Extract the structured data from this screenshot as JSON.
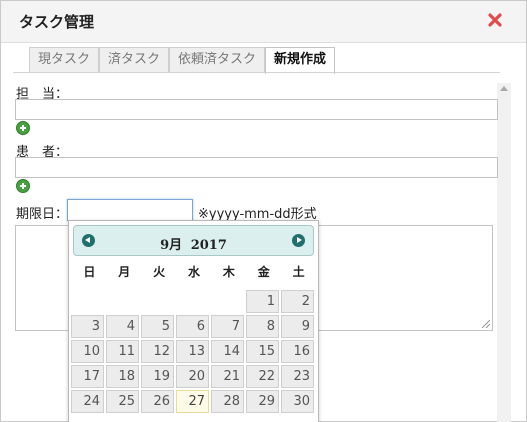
{
  "window": {
    "title": "タスク管理"
  },
  "tabs": [
    {
      "label": "現タスク",
      "active": false
    },
    {
      "label": "済タスク",
      "active": false
    },
    {
      "label": "依頼済タスク",
      "active": false
    },
    {
      "label": "新規作成",
      "active": true
    }
  ],
  "form": {
    "assignee_label": "担　当：",
    "assignee_value": "",
    "patient_label": "患　者：",
    "patient_value": "",
    "due_label": "期限日：",
    "due_value": "",
    "due_hint": "※yyyy-mm-dd形式",
    "notes_value": ""
  },
  "datepicker": {
    "month": "9月",
    "year": "2017",
    "weekdays": [
      "日",
      "月",
      "火",
      "水",
      "木",
      "金",
      "土"
    ],
    "weeks": [
      [
        "",
        "",
        "",
        "",
        "",
        "1",
        "2"
      ],
      [
        "3",
        "4",
        "5",
        "6",
        "7",
        "8",
        "9"
      ],
      [
        "10",
        "11",
        "12",
        "13",
        "14",
        "15",
        "16"
      ],
      [
        "17",
        "18",
        "19",
        "20",
        "21",
        "22",
        "23"
      ],
      [
        "24",
        "25",
        "26",
        "27",
        "28",
        "29",
        "30"
      ]
    ],
    "today": "27"
  },
  "colors": {
    "close_icon": "#e24b4b",
    "header_bg": "#dcefef",
    "nav_button": "#1f6f6c",
    "add_icon": "#48a040",
    "today_bg": "#fdfbe7"
  },
  "icons": {
    "close": "close-icon",
    "add": "add-circle-icon",
    "prev": "chevron-left-circle-icon",
    "next": "chevron-right-circle-icon"
  }
}
